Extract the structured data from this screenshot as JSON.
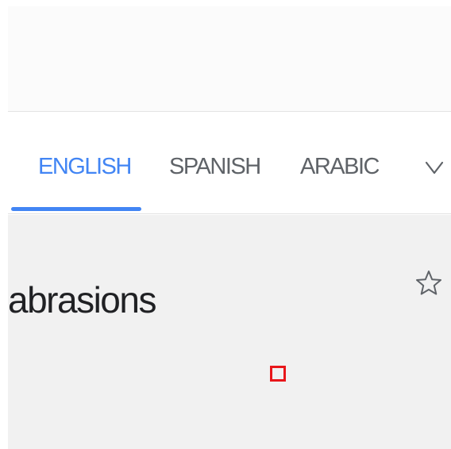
{
  "tabs": [
    {
      "label": "ENGLISH",
      "active": true
    },
    {
      "label": "SPANISH",
      "active": false
    },
    {
      "label": "ARABIC",
      "active": false
    }
  ],
  "more_icon": "chevron-down-icon",
  "result": {
    "word": "abrasions",
    "star_icon": "star-outline-icon"
  },
  "colors": {
    "accent": "#4285f4",
    "tab_inactive": "#5f6368",
    "result_background": "#f1f1f1",
    "marker": "#e8161a"
  }
}
